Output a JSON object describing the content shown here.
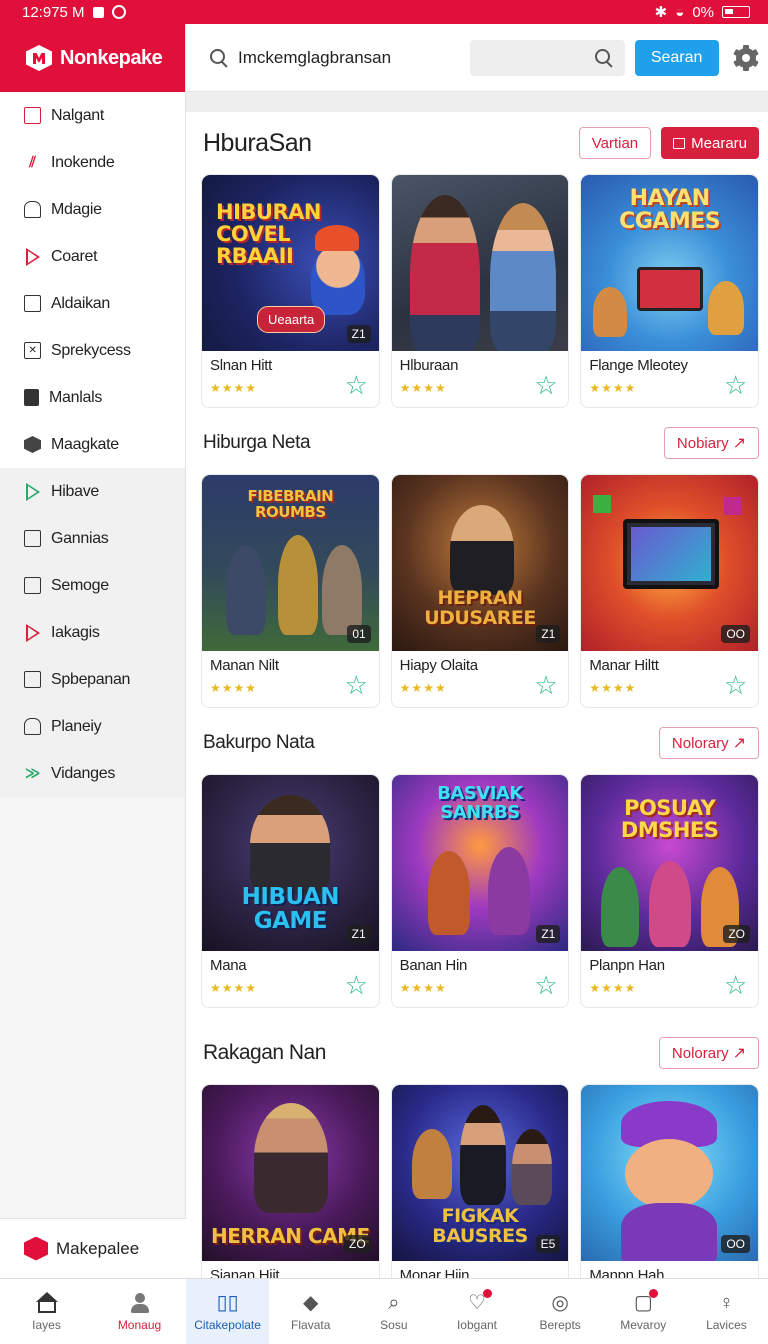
{
  "status_bar": {
    "time": "12:975 M",
    "battery": "0%"
  },
  "brand": {
    "name": "Nonkepake"
  },
  "sidebar": {
    "items": [
      {
        "label": "Nalgant",
        "icon": "square-icon"
      },
      {
        "label": "Inokende",
        "icon": "slash-icon"
      },
      {
        "label": "Mdagie",
        "icon": "lock-icon"
      },
      {
        "label": "Coaret",
        "icon": "play-icon"
      },
      {
        "label": "Aldaikan",
        "icon": "document-icon"
      },
      {
        "label": "Sprekycess",
        "icon": "grid-icon"
      },
      {
        "label": "Manlals",
        "icon": "book-icon"
      },
      {
        "label": "Maagkate",
        "icon": "cube-icon"
      },
      {
        "label": "Hibave",
        "icon": "play-icon"
      },
      {
        "label": "Gannias",
        "icon": "document-icon"
      },
      {
        "label": "Semoge",
        "icon": "square-icon"
      },
      {
        "label": "Iakagis",
        "icon": "play-icon"
      },
      {
        "label": "Spbepanan",
        "icon": "edit-icon"
      },
      {
        "label": "Planeiy",
        "icon": "lock-icon"
      },
      {
        "label": "Vidanges",
        "icon": "arrow-icon"
      }
    ],
    "footer": "Makepalee"
  },
  "header": {
    "search_text": "Imckemglagbransan",
    "search_button": "Searan"
  },
  "sections": [
    {
      "title": "HburaSan",
      "buttons": [
        "Vartian",
        "Meararu"
      ],
      "cards": [
        {
          "name": "Slnan Hitt",
          "badge": "Z1",
          "thumb_title": "HIBURAN COVEL RBAAII",
          "thumb_button": "Ueaarta"
        },
        {
          "name": "Hlburaan",
          "badge": "",
          "thumb_title": "",
          "thumb_button": ""
        },
        {
          "name": "Flange Mleotey",
          "badge": "",
          "thumb_title": "HAYAN CGAMES",
          "thumb_button": ""
        }
      ]
    },
    {
      "title": "Hiburga Neta",
      "buttons": [
        "Nobiary"
      ],
      "cards": [
        {
          "name": "Manan Nilt",
          "badge": "01",
          "thumb_title": "FIBEBRAIN ROUMBS",
          "thumb_button": ""
        },
        {
          "name": "Hiapy Olaita",
          "badge": "Z1",
          "thumb_title": "HEPRAN UDUSAREE",
          "thumb_button": ""
        },
        {
          "name": "Manar Hiltt",
          "badge": "OO",
          "thumb_title": "",
          "thumb_button": ""
        }
      ]
    },
    {
      "title": "Bakurpo Nata",
      "buttons": [
        "Nolorary"
      ],
      "cards": [
        {
          "name": "Mana",
          "badge": "Z1",
          "thumb_title": "HIBUAN GAME",
          "thumb_button": ""
        },
        {
          "name": "Banan Hin",
          "badge": "Z1",
          "thumb_title": "BASVIAK SANRBS",
          "thumb_button": ""
        },
        {
          "name": "Planpn Han",
          "badge": "ZO",
          "thumb_title": "POSUAY DMSHES",
          "thumb_button": ""
        }
      ]
    },
    {
      "title": "Rakagan Nan",
      "buttons": [
        "Nolorary"
      ],
      "cards": [
        {
          "name": "Sianan Hiit",
          "badge": "ZO",
          "thumb_title": "HERRAN CAME",
          "thumb_button": ""
        },
        {
          "name": "Monar Hiin",
          "badge": "E5",
          "thumb_title": "FIGKAK BAUSRES",
          "thumb_button": ""
        },
        {
          "name": "Manpn Hah",
          "badge": "OO",
          "thumb_title": "",
          "thumb_button": ""
        }
      ]
    }
  ],
  "bottom_nav": [
    {
      "label": "Iayes",
      "icon": "home-icon"
    },
    {
      "label": "Monaug",
      "icon": "user-icon"
    },
    {
      "label": "Citakepolate",
      "icon": "chart-icon"
    },
    {
      "label": "Flavata",
      "icon": "diamond-icon"
    },
    {
      "label": "Sosu",
      "icon": "search-icon"
    },
    {
      "label": "Iobgant",
      "icon": "heart-icon"
    },
    {
      "label": "Berepts",
      "icon": "target-icon"
    },
    {
      "label": "Mevaroy",
      "icon": "bag-icon"
    },
    {
      "label": "Lavices",
      "icon": "person-icon"
    }
  ],
  "colors": {
    "brand_red": "#e0103a",
    "search_blue": "#1ea0ec",
    "star_gold": "#e8b923",
    "fav_green": "#2dbb84"
  }
}
